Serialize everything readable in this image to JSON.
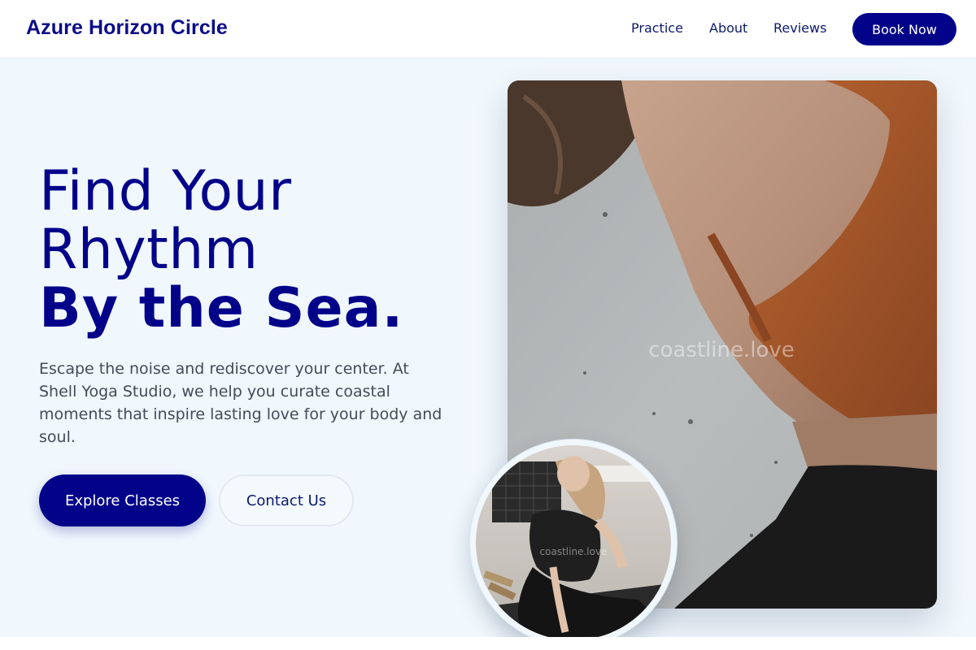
{
  "header": {
    "brand": "Azure Horizon Circle",
    "nav": [
      {
        "label": "Practice"
      },
      {
        "label": "About"
      },
      {
        "label": "Reviews"
      }
    ],
    "cta": "Book Now"
  },
  "hero": {
    "title_line1": "Find Your",
    "title_line2": "Rhythm",
    "title_bold": "By the Sea.",
    "description": "Escape the noise and rediscover your center. At Shell Yoga Studio, we help you curate coastal moments that inspire lasting love for your body and soul.",
    "primary_button": "Explore Classes",
    "secondary_button": "Contact Us"
  },
  "images": {
    "main_watermark": "coastline.love",
    "circle_watermark": "coastline.love"
  },
  "colors": {
    "brand": "#0b0b8a",
    "primary": "#03038a",
    "background": "#f0f7fd",
    "text": "#434b59"
  }
}
